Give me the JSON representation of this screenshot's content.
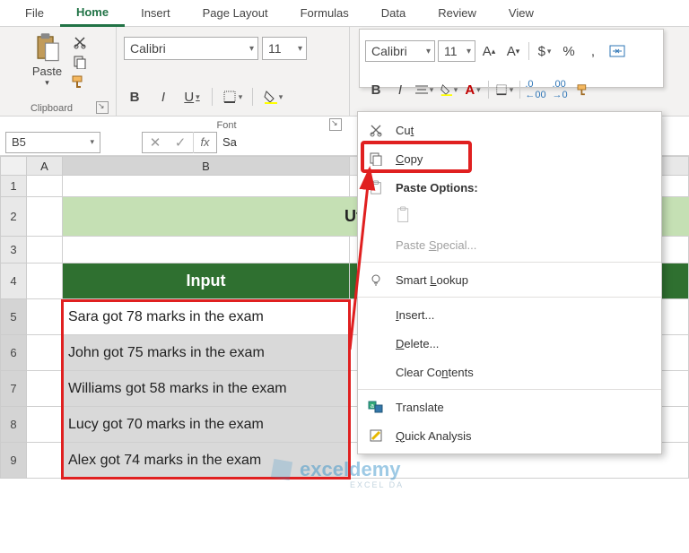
{
  "tabs": [
    "File",
    "Home",
    "Insert",
    "Page Layout",
    "Formulas",
    "Data",
    "Review",
    "View"
  ],
  "active_tab": "Home",
  "ribbon": {
    "clipboard_label": "Clipboard",
    "paste_label": "Paste",
    "font_label": "Font",
    "font_name": "Calibri",
    "font_size": "11"
  },
  "mini_toolbar": {
    "font_name": "Calibri",
    "font_size": "11",
    "currency": "$",
    "percent": "%",
    "comma": ","
  },
  "name_box": "B5",
  "formula_bar": "Sa",
  "columns": [
    "A",
    "B"
  ],
  "row_numbers": [
    "1",
    "2",
    "3",
    "4",
    "5",
    "6",
    "7",
    "8",
    "9"
  ],
  "title_text": "Utilizing",
  "header_input": "Input",
  "data_rows": [
    "Sara got 78 marks in the exam",
    "John got 75 marks in the exam",
    "Williams got 58 marks in the exam",
    "Lucy got 70 marks in the exam",
    "Alex got 74 marks in the exam"
  ],
  "context_menu": {
    "cut": "Cut",
    "copy": "Copy",
    "paste_options": "Paste Options:",
    "paste_special": "Paste Special...",
    "smart_lookup": "Smart Lookup",
    "insert": "Insert...",
    "delete": "Delete...",
    "clear_contents": "Clear Contents",
    "translate": "Translate",
    "quick_analysis": "Quick Analysis"
  },
  "watermark": "exceldemy",
  "watermark_sub": "EXCEL DA"
}
